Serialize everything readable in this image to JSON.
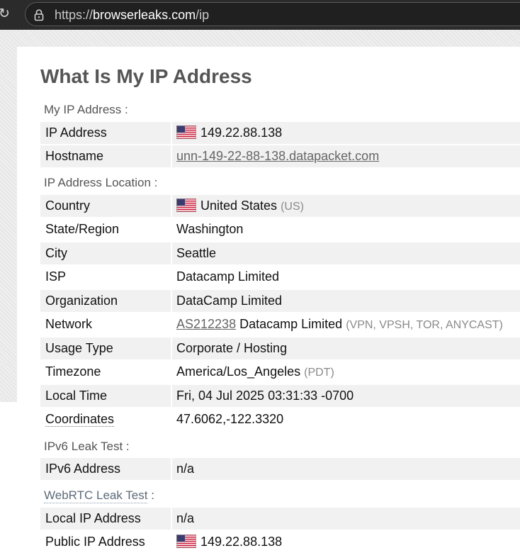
{
  "browser": {
    "url_scheme": "https://",
    "url_host": "browserleaks.com",
    "url_path": "/ip",
    "reload_icon": "reload-icon",
    "lock_icon": "lock-icon"
  },
  "page": {
    "title": "What Is My IP Address"
  },
  "sections": {
    "my_ip": "My IP Address :",
    "location": "IP Address Location :",
    "ipv6": "IPv6 Leak Test :",
    "webrtc": "WebRTC Leak Test",
    "webrtc_colon": " :"
  },
  "ip_address": {
    "label": "IP Address",
    "value": "149.22.88.138",
    "flag_icon": "us-flag-icon"
  },
  "hostname": {
    "label": "Hostname",
    "value": "unn-149-22-88-138.datapacket.com"
  },
  "country": {
    "label": "Country",
    "value": "United States",
    "code": "(US)",
    "flag_icon": "us-flag-icon"
  },
  "state": {
    "label": "State/Region",
    "value": "Washington"
  },
  "city": {
    "label": "City",
    "value": "Seattle"
  },
  "isp": {
    "label": "ISP",
    "value": "Datacamp Limited"
  },
  "organization": {
    "label": "Organization",
    "value": "DataCamp Limited"
  },
  "network": {
    "label": "Network",
    "asn": "AS212238",
    "name": "Datacamp Limited",
    "tags": "(VPN, VPSH, TOR, ANYCAST)"
  },
  "usage_type": {
    "label": "Usage Type",
    "value": "Corporate / Hosting"
  },
  "timezone": {
    "label": "Timezone",
    "value": "America/Los_Angeles",
    "abbr": "(PDT)"
  },
  "local_time": {
    "label": "Local Time",
    "value": "Fri, 04 Jul 2025 03:31:33 -0700"
  },
  "coordinates": {
    "label": "Coordinates",
    "value": "47.6062,-122.3320"
  },
  "ipv6_address": {
    "label": "IPv6 Address",
    "value": "n/a"
  },
  "local_ip": {
    "label": "Local IP Address",
    "value": "n/a"
  },
  "public_ip": {
    "label": "Public IP Address",
    "value": "149.22.88.138",
    "flag_icon": "us-flag-icon"
  },
  "colors": {
    "row_bg": "#f1f1f1",
    "heading": "#555555",
    "browser_bar": "#2b2b2b"
  }
}
